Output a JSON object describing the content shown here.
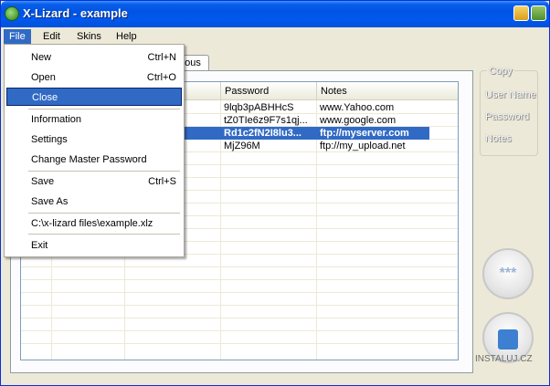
{
  "window": {
    "title": "X-Lizard - example"
  },
  "menubar": {
    "file": "File",
    "edit": "Edit",
    "skins": "Skins",
    "help": "Help"
  },
  "file_menu": {
    "new": "New",
    "new_sc": "Ctrl+N",
    "open": "Open",
    "open_sc": "Ctrl+O",
    "close": "Close",
    "information": "Information",
    "settings": "Settings",
    "change_master": "Change Master Password",
    "save": "Save",
    "save_sc": "Ctrl+S",
    "save_as": "Save As",
    "recent_file": "C:\\x-lizard files\\example.xlz",
    "exit": "Exit"
  },
  "tab": {
    "label": "eous"
  },
  "grid": {
    "headers": [
      "Password",
      "Notes"
    ],
    "rows": [
      [
        "9lqb3pABHHcS",
        "www.Yahoo.com"
      ],
      [
        "tZ0TIe6z9F7s1qj...",
        "www.google.com"
      ],
      [
        "Rd1c2fN2I8lu3...",
        "ftp://myserver.com"
      ],
      [
        "MjZ96M",
        "ftp://my_upload.net"
      ]
    ],
    "selected_row": 2
  },
  "side": {
    "copy_title": "Copy",
    "user_name": "User Name",
    "password": "Password",
    "notes": "Notes",
    "reveal_button": "***"
  },
  "watermark": "INSTALUJ.CZ",
  "colors": {
    "titlebar": "#0054e3",
    "selection": "#316ac5",
    "face": "#ece9d8"
  }
}
